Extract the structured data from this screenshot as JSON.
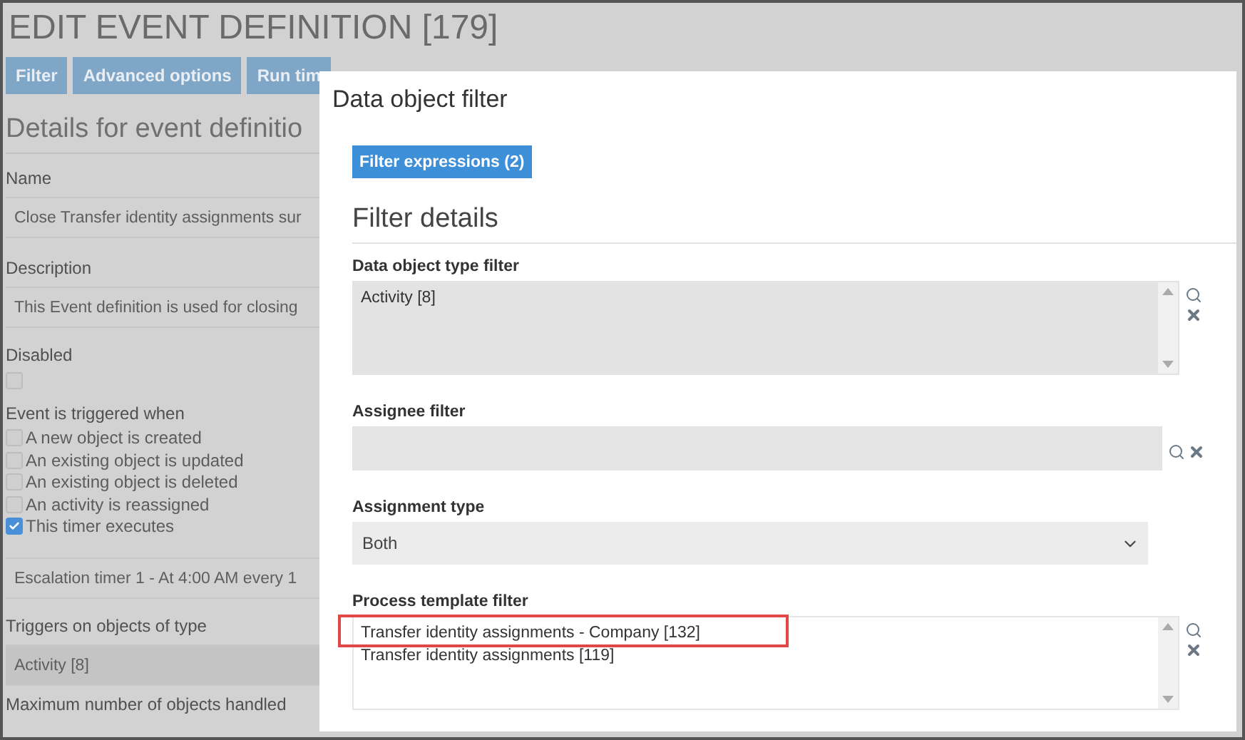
{
  "page": {
    "title": "EDIT EVENT DEFINITION [179]",
    "buttons": [
      "Filter",
      "Advanced options",
      "Run tim"
    ],
    "section_title": "Details for event definitio",
    "fields": [
      {
        "label": "Name",
        "value": "Close Transfer identity assignments sur"
      },
      {
        "label": "Description",
        "value": "This Event definition is used for closing"
      }
    ],
    "disabled": {
      "label": "Disabled",
      "checked": false
    },
    "triggers": {
      "label": "Event is triggered when",
      "options": [
        {
          "label": "A new object is created",
          "checked": false
        },
        {
          "label": "An existing object is updated",
          "checked": false
        },
        {
          "label": "An existing object is deleted",
          "checked": false
        },
        {
          "label": "An activity is reassigned",
          "checked": false
        },
        {
          "label": "This timer executes",
          "checked": true
        }
      ]
    },
    "timer": "Escalation timer 1 - At 4:00 AM every 1",
    "object_type": {
      "label": "Triggers on objects of type",
      "value": "Activity [8]"
    },
    "next_label": "Maximum number of objects handled"
  },
  "dialog": {
    "title": "Data object filter",
    "tab": {
      "label": "Filter expressions (2)",
      "selected": true
    },
    "section_title": "Filter details",
    "fields": [
      {
        "kind": "list",
        "label": "Data object type filter",
        "disabled": true,
        "items": [
          {
            "text": "Activity [8]",
            "highlighted": false
          }
        ]
      },
      {
        "kind": "lookup",
        "label": "Assignee filter"
      },
      {
        "kind": "select",
        "label": "Assignment type",
        "value": "Both"
      },
      {
        "kind": "list",
        "label": "Process template filter",
        "disabled": false,
        "items": [
          {
            "text": "Transfer identity assignments - Company [132]",
            "highlighted": true
          },
          {
            "text": "Transfer identity assignments [119]",
            "highlighted": false
          }
        ]
      }
    ]
  }
}
